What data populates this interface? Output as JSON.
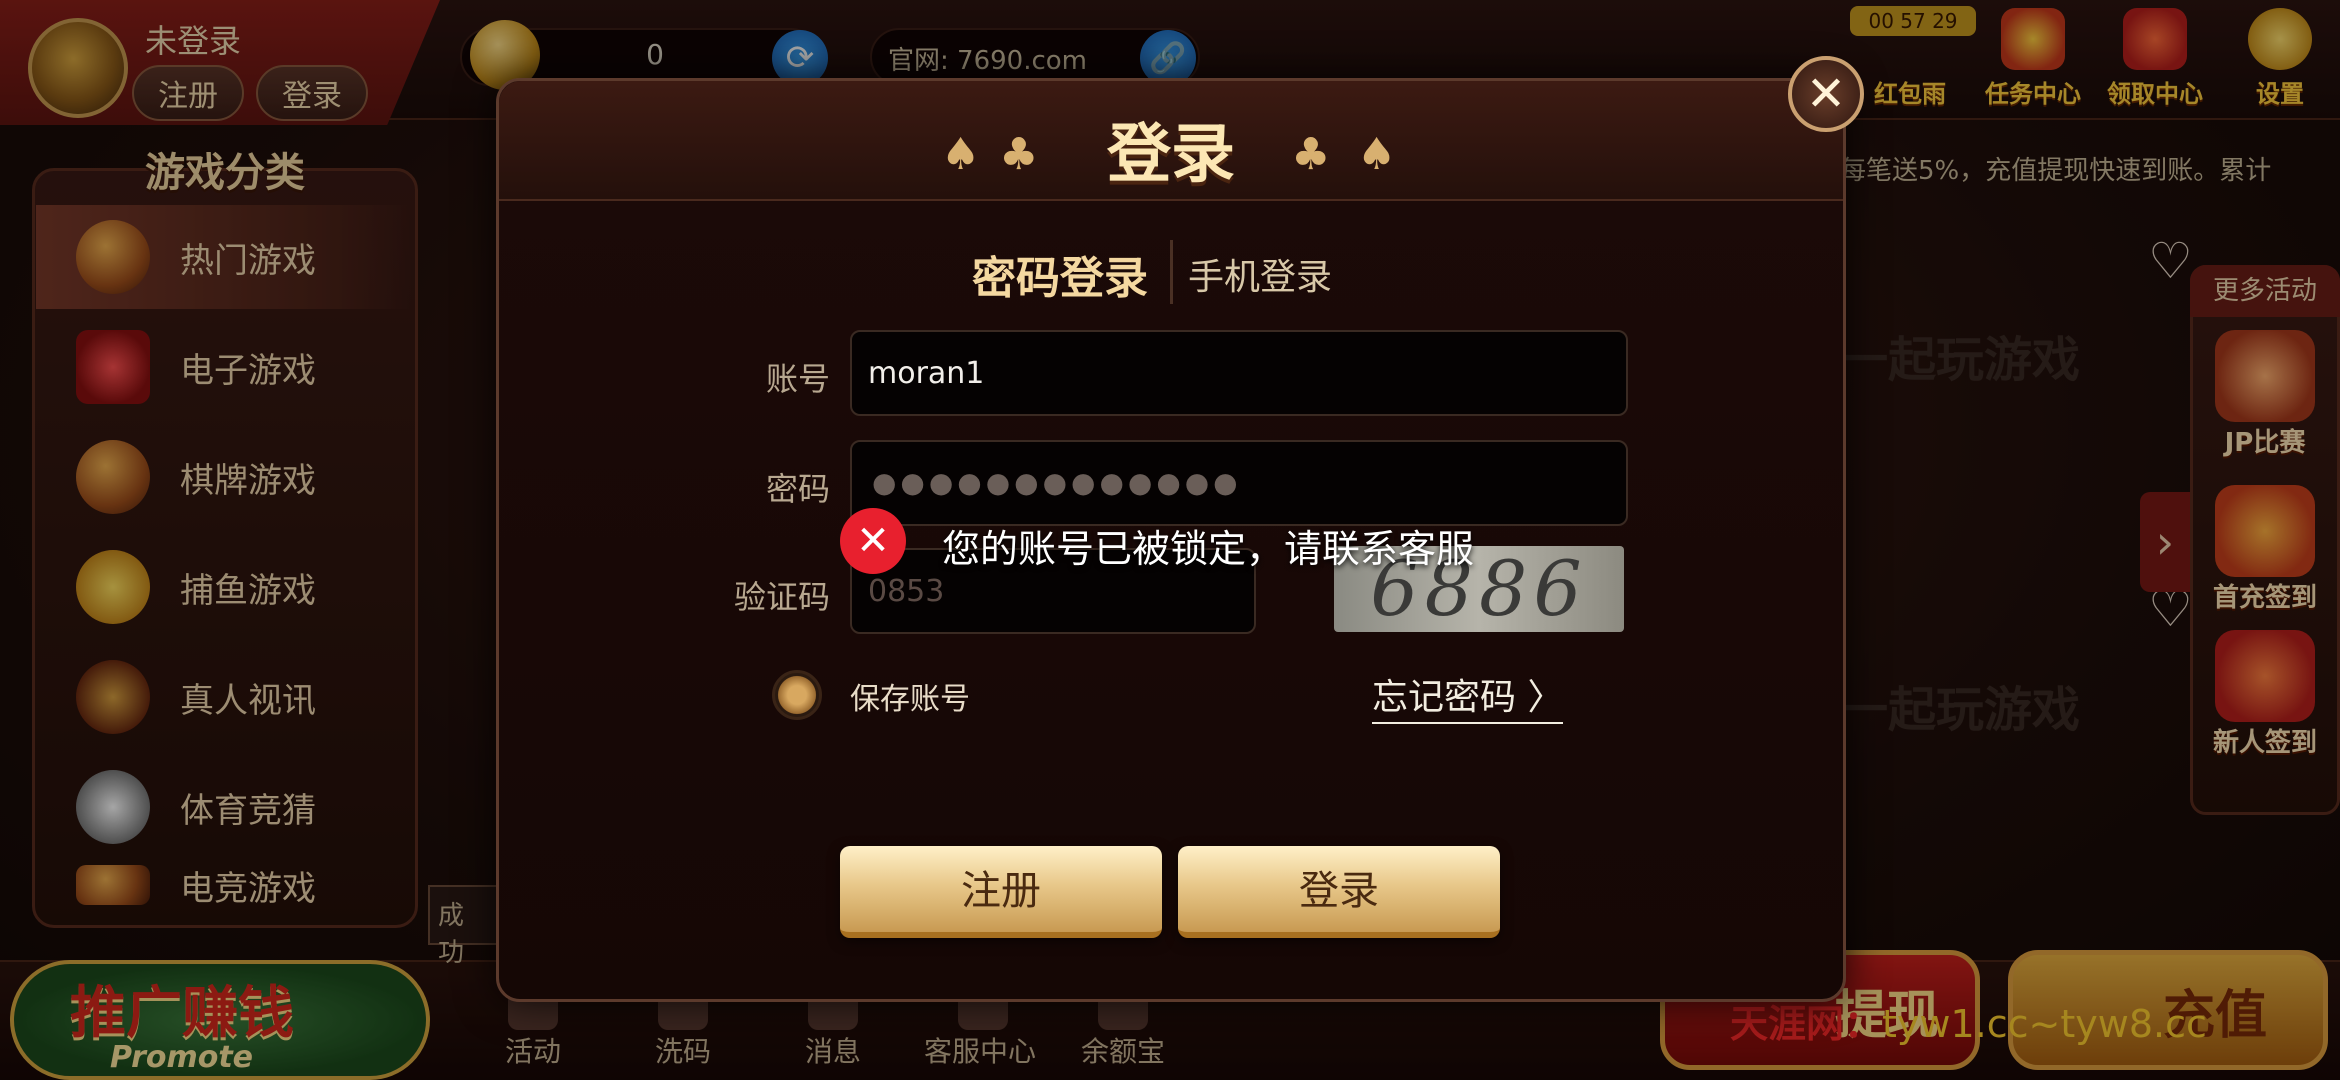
{
  "user": {
    "status": "未登录",
    "register_label": "注册",
    "login_label": "登录"
  },
  "balance": {
    "value": "0"
  },
  "site": {
    "label": "官网: 7690.com"
  },
  "top_icons": {
    "timer": "00 57 29",
    "red_packet": "红包雨",
    "task_center": "任务中心",
    "claim_center": "领取中心",
    "settings": "设置"
  },
  "marquee": "每笔送5%，充值提现快速到账。累计",
  "categories": {
    "title": "游戏分类",
    "items": [
      {
        "label": "热门游戏",
        "icon": "hot-games-icon"
      },
      {
        "label": "电子游戏",
        "icon": "slot-games-icon"
      },
      {
        "label": "棋牌游戏",
        "icon": "card-games-icon"
      },
      {
        "label": "捕鱼游戏",
        "icon": "fishing-games-icon"
      },
      {
        "label": "真人视讯",
        "icon": "live-casino-icon"
      },
      {
        "label": "体育竞猜",
        "icon": "sports-icon"
      },
      {
        "label": "电竞游戏",
        "icon": "esports-icon"
      }
    ]
  },
  "right_panel": {
    "title": "更多活动",
    "items": [
      {
        "label": "JP比赛"
      },
      {
        "label": "首充签到"
      },
      {
        "label": "新人签到"
      }
    ]
  },
  "game_cards": {
    "brand": "一起玩游戏",
    "domain": "7690.com"
  },
  "bottom_nav": {
    "promote_cn": "推广赚钱",
    "promote_en": "Promote",
    "items": [
      "活动",
      "洗码",
      "消息",
      "客服中心",
      "余额宝"
    ],
    "withdraw": "提现",
    "recharge": "充值",
    "toast_left": "成功"
  },
  "watermark": {
    "brand": "天涯网：",
    "url": "tyw1.cc~tyw8.cc"
  },
  "dialog": {
    "title": "登录",
    "tab_password": "密码登录",
    "tab_phone": "手机登录",
    "account_label": "账号",
    "account_value": "moran1",
    "password_label": "密码",
    "password_mask": "●●●●●●●●●●●●●",
    "captcha_label": "验证码",
    "captcha_value": "0853",
    "captcha_image_text": "6886",
    "save_account_label": "保存账号",
    "forgot_password": "忘记密码 〉",
    "register_button": "注册",
    "login_button": "登录",
    "close_symbol": "✕"
  },
  "toast": {
    "message": "您的账号已被锁定，请联系客服",
    "icon": "error-x-icon"
  },
  "colors": {
    "accent_gold": "#f4d8a0",
    "error_red": "#e8202e",
    "dialog_bg": "#1c0a08"
  }
}
